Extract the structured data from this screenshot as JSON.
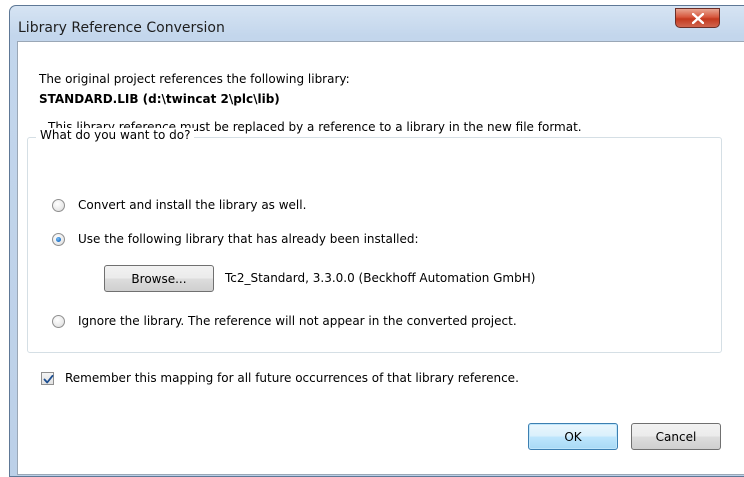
{
  "window": {
    "title": "Library Reference Conversion",
    "close_glyph": "X"
  },
  "dialog": {
    "intro_line": "The original project references the following library:",
    "library_name": "STANDARD.LIB (d:\\twincat 2\\plc\\lib)",
    "replace_notice": "This library reference must be replaced by a reference to a library in the new file format.",
    "group_title": "What do you want to do?",
    "options": [
      {
        "label": "Convert and install the library as well.",
        "selected": false
      },
      {
        "label": "Use the following library that has already been installed:",
        "selected": true
      },
      {
        "label": "Ignore the library. The reference will not appear in the converted project.",
        "selected": false
      }
    ],
    "browse_button": "Browse...",
    "selected_library": "Tc2_Standard, 3.3.0.0 (Beckhoff Automation GmbH)",
    "remember_label": "Remember this mapping for all future occurrences of that library reference.",
    "remember_checked": true,
    "ok_button": "OK",
    "cancel_button": "Cancel"
  },
  "colors": {
    "title_bar": "#c3d6ec",
    "close_button": "#c4391f",
    "radio_selected": "#1a6dc4",
    "default_button_border": "#3c7fb1"
  },
  "icons": {
    "close": "close-x-icon",
    "check": "checkmark-icon"
  }
}
